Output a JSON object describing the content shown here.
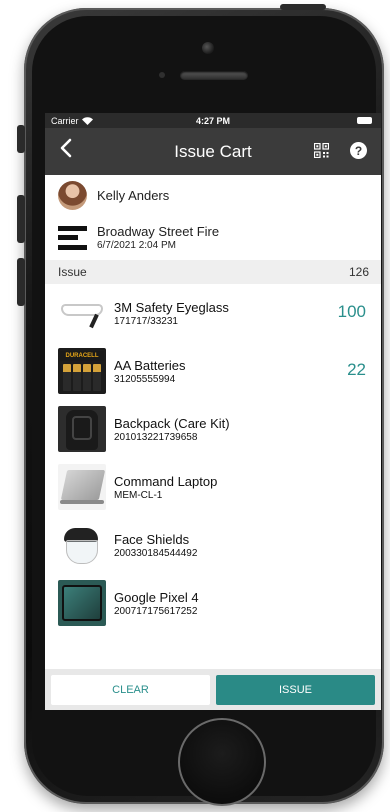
{
  "status_bar": {
    "carrier": "Carrier",
    "time": "4:27 PM"
  },
  "nav": {
    "title": "Issue Cart",
    "back_icon": "chevron-left-icon",
    "qr_icon": "qr-code-icon",
    "help_label": "?"
  },
  "person": {
    "name": "Kelly Anders"
  },
  "location": {
    "name": "Broadway Street Fire",
    "datetime": "6/7/2021 2:04 PM"
  },
  "section": {
    "label": "Issue",
    "count": "126"
  },
  "items": [
    {
      "name": "3M Safety Eyeglass",
      "code": "171717/33231",
      "qty": "100"
    },
    {
      "name": "AA Batteries",
      "code": "31205555994",
      "qty": "22"
    },
    {
      "name": "Backpack (Care Kit)",
      "code": "201013221739658",
      "qty": ""
    },
    {
      "name": "Command Laptop",
      "code": "MEM-CL-1",
      "qty": ""
    },
    {
      "name": "Face Shields",
      "code": "200330184544492",
      "qty": ""
    },
    {
      "name": "Google Pixel 4",
      "code": "200717175617252",
      "qty": ""
    }
  ],
  "battery_brand": "DURACELL",
  "actions": {
    "clear_label": "CLEAR",
    "issue_label": "ISSUE"
  },
  "colors": {
    "accent": "#2a8a86",
    "navbar": "#3b3b3b",
    "statusbar": "#2b2b2b"
  }
}
